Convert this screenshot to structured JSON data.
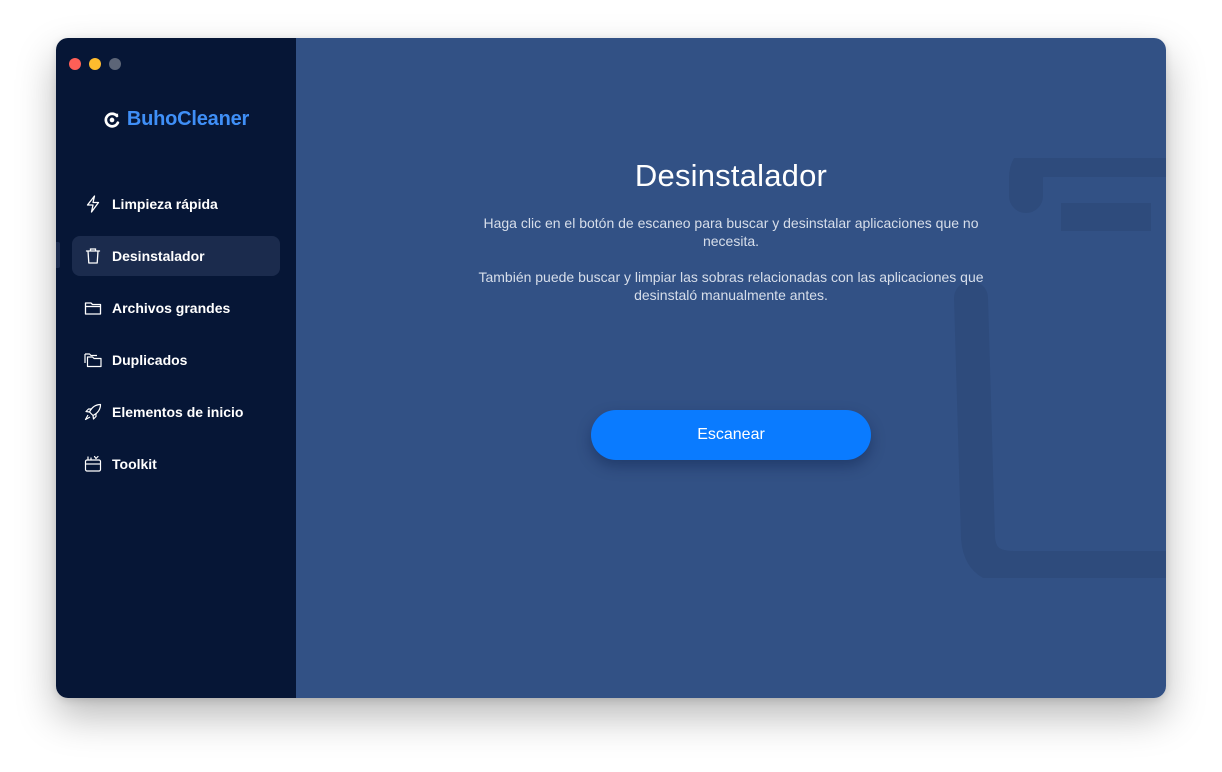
{
  "app": {
    "name": "BuhoCleaner",
    "brand_color": "#3f8ff7"
  },
  "sidebar": {
    "items": [
      {
        "label": "Limpieza rápida",
        "icon": "lightning-icon",
        "active": false
      },
      {
        "label": "Desinstalador",
        "icon": "trash-icon",
        "active": true
      },
      {
        "label": "Archivos grandes",
        "icon": "folder-icon",
        "active": false
      },
      {
        "label": "Duplicados",
        "icon": "duplicate-folder-icon",
        "active": false
      },
      {
        "label": "Elementos de inicio",
        "icon": "rocket-icon",
        "active": false
      },
      {
        "label": "Toolkit",
        "icon": "toolkit-icon",
        "active": false
      }
    ]
  },
  "main": {
    "title": "Desinstalador",
    "description_1": "Haga clic en el botón de escaneo para buscar y desinstalar aplicaciones que no necesita.",
    "description_2": "También puede buscar y limpiar las sobras relacionadas con las aplicaciones que desinstaló manualmente antes.",
    "scan_button": "Escanear",
    "accent_color": "#0a7bff",
    "background_icon": "trash-icon"
  }
}
